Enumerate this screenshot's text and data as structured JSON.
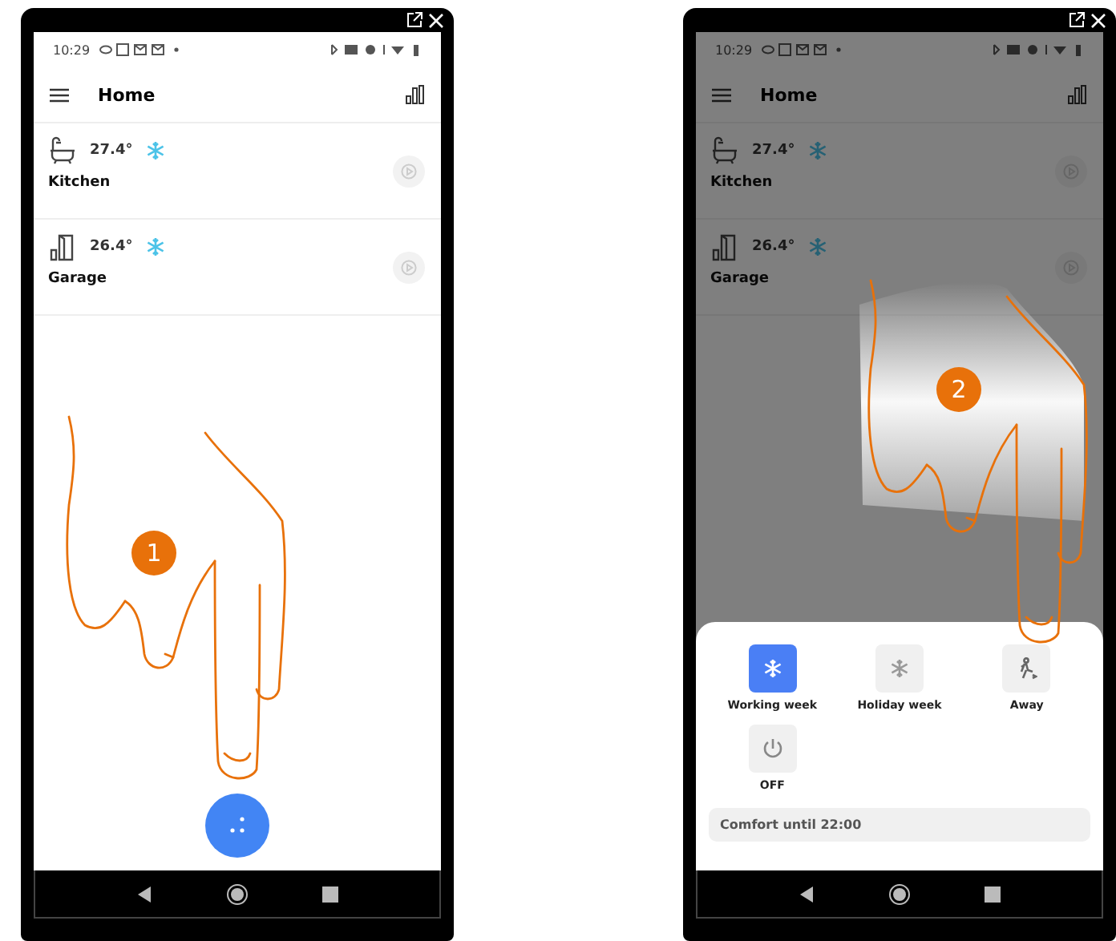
{
  "phones": [
    {
      "kind": "home",
      "step": "1",
      "dimmed": false,
      "status_time": "10:29",
      "title": "Home",
      "rooms": [
        {
          "kind": "bath",
          "temperature": "27.4°",
          "name": "Kitchen"
        },
        {
          "kind": "door",
          "temperature": "26.4°",
          "name": "Garage"
        }
      ]
    },
    {
      "kind": "modes",
      "step": "2",
      "dimmed": true,
      "status_time": "10:29",
      "title": "Home",
      "rooms": [
        {
          "kind": "bath",
          "temperature": "27.4°",
          "name": "Kitchen"
        },
        {
          "kind": "door",
          "temperature": "26.4°",
          "name": "Garage"
        }
      ],
      "modes": [
        {
          "kind": "snowflake",
          "label": "Working week",
          "selected": true
        },
        {
          "kind": "snowflake",
          "label": "Holiday week",
          "selected": false
        },
        {
          "kind": "away",
          "label": "Away",
          "selected": false
        },
        {
          "kind": "power",
          "label": "OFF",
          "selected": false
        }
      ],
      "status": "Comfort until 22:00"
    }
  ]
}
